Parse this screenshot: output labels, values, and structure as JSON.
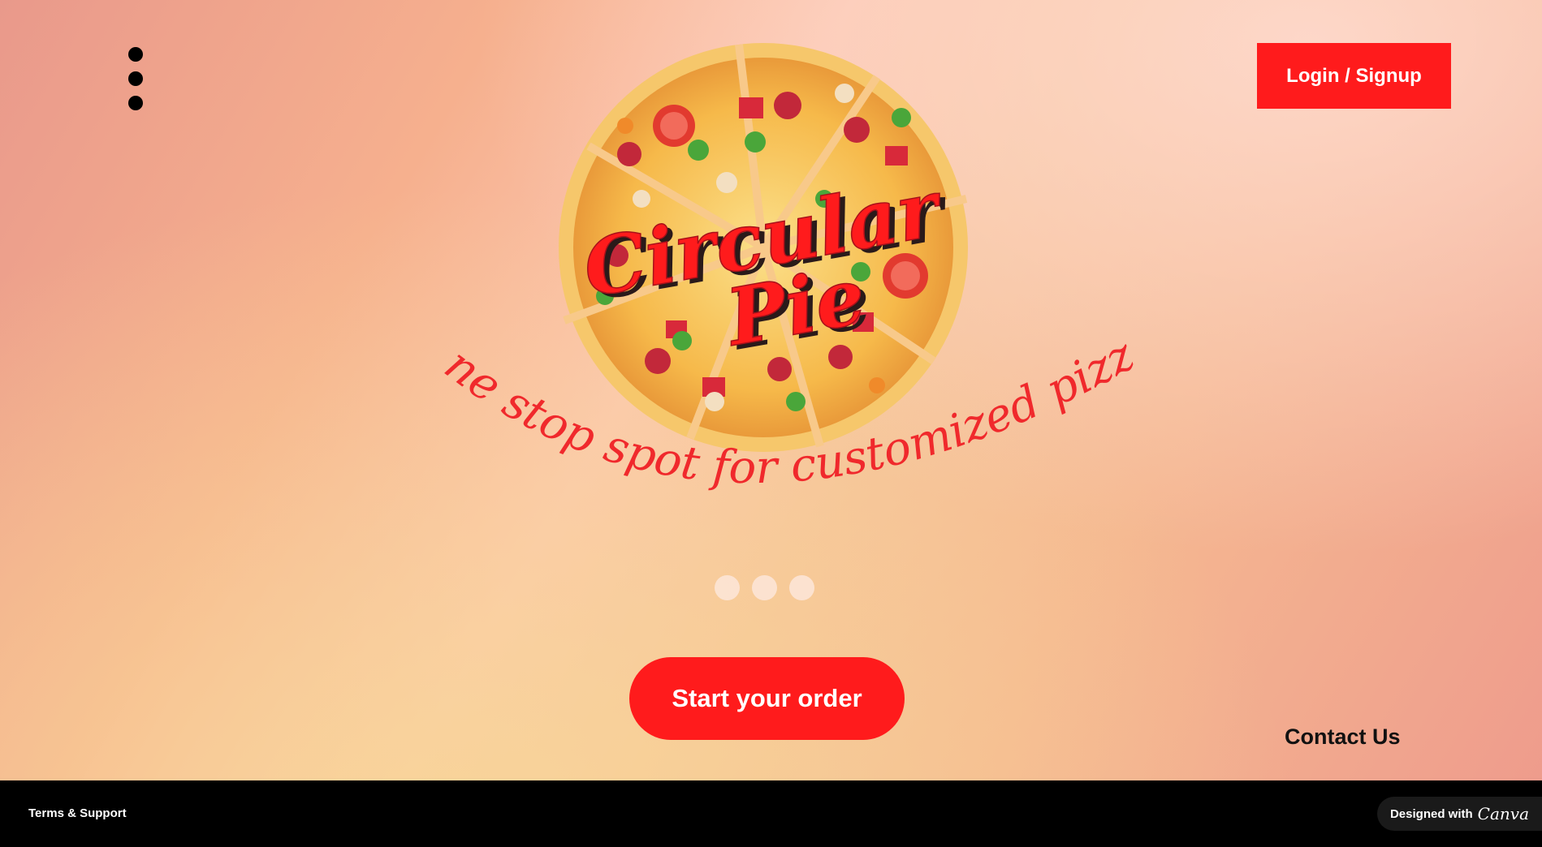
{
  "header": {
    "menu_icon": "vertical-ellipsis-icon",
    "login_label": "Login / Signup"
  },
  "logo": {
    "line1": "Circular",
    "line2": "Pie",
    "tagline": "One stop spot for customized pizza"
  },
  "carousel": {
    "dots": 3
  },
  "cta": {
    "order_label": "Start your order"
  },
  "contact_label": "Contact Us",
  "footer": {
    "terms_label": "Terms & Support",
    "designed_with": "Designed with",
    "brand": "Canva"
  },
  "colors": {
    "accent": "#ff1b1c",
    "footer_bg": "#000000"
  }
}
